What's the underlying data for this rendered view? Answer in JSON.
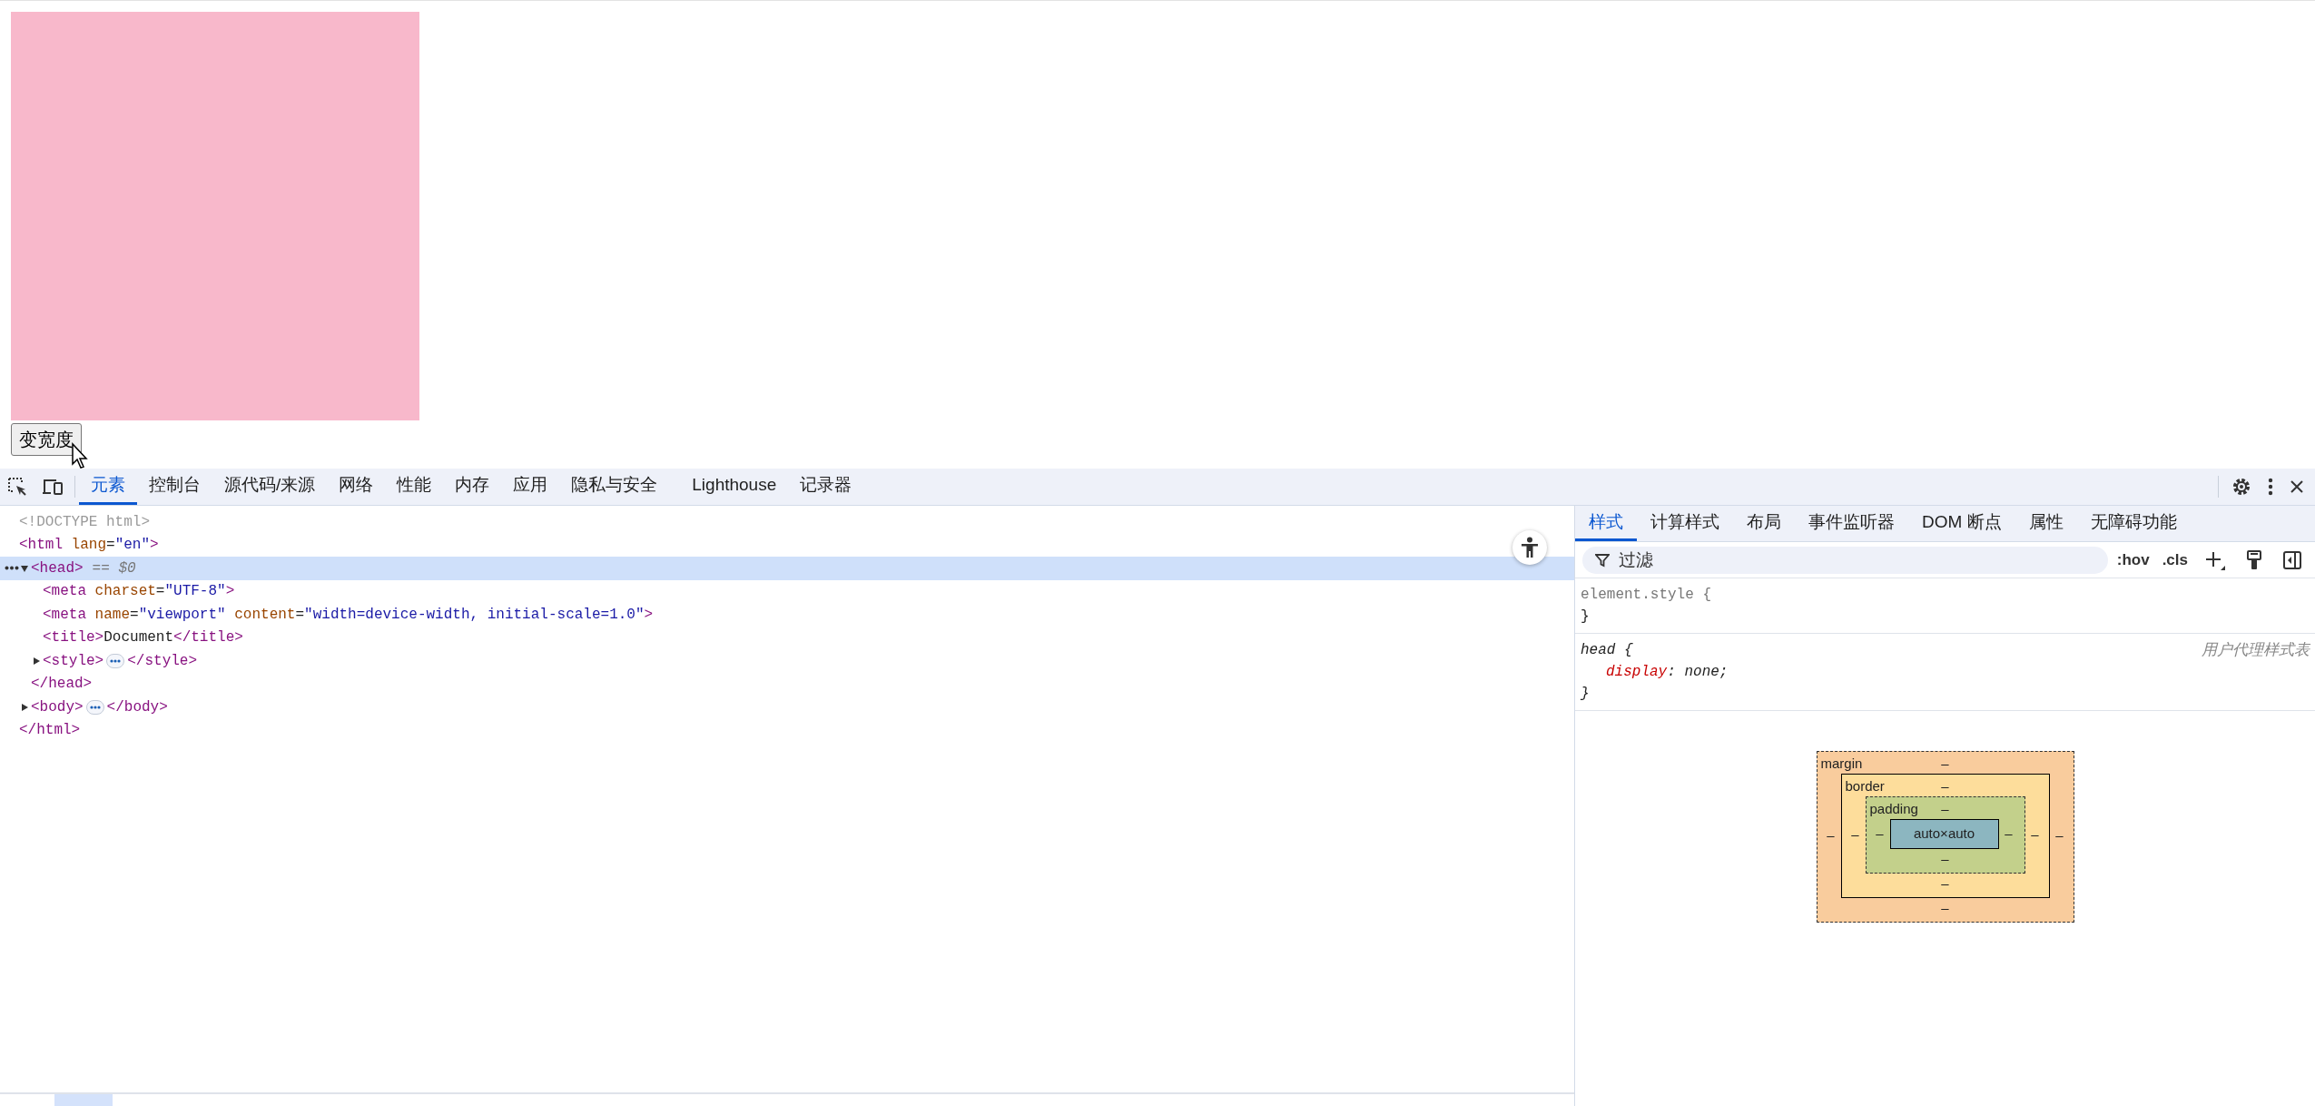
{
  "page": {
    "button": "变宽度"
  },
  "devtools": {
    "tabs": [
      {
        "label": "元素",
        "selected": true
      },
      {
        "label": "控制台",
        "selected": false
      },
      {
        "label": "源代码/来源",
        "selected": false
      },
      {
        "label": "网络",
        "selected": false
      },
      {
        "label": "性能",
        "selected": false
      },
      {
        "label": "内存",
        "selected": false
      },
      {
        "label": "应用",
        "selected": false
      },
      {
        "label": "隐私与安全",
        "selected": false
      },
      {
        "label": "Lighthouse",
        "selected": false
      },
      {
        "label": "记录器",
        "selected": false
      }
    ],
    "dom_tree": [
      {
        "selected": false,
        "tokens": [
          {
            "text": "<!DOCTYPE html>",
            "kind": "doctype"
          }
        ]
      },
      {
        "selected": false,
        "tokens": [
          {
            "text": "<html",
            "kind": "tag"
          },
          {
            "text": " lang",
            "kind": "attr"
          },
          {
            "text": "=",
            "kind": "punct"
          },
          {
            "text": "\"en\"",
            "kind": "value"
          },
          {
            "text": ">",
            "kind": "tag"
          }
        ],
        "close": [
          {
            "text": "</html>",
            "kind": "tag"
          }
        ],
        "children": [
          {
            "selected": true,
            "expanded": true,
            "hint": "== $0",
            "tokens": [
              {
                "text": "<head>",
                "kind": "tag"
              }
            ],
            "close": [
              {
                "text": "</head>",
                "kind": "tag"
              }
            ],
            "children": [
              {
                "selected": false,
                "tokens": [
                  {
                    "text": "<meta",
                    "kind": "tag"
                  },
                  {
                    "text": " charset",
                    "kind": "attr"
                  },
                  {
                    "text": "=",
                    "kind": "punct"
                  },
                  {
                    "text": "\"UTF-8\"",
                    "kind": "value"
                  },
                  {
                    "text": ">",
                    "kind": "tag"
                  }
                ]
              },
              {
                "selected": false,
                "tokens": [
                  {
                    "text": "<meta",
                    "kind": "tag"
                  },
                  {
                    "text": " name",
                    "kind": "attr"
                  },
                  {
                    "text": "=",
                    "kind": "punct"
                  },
                  {
                    "text": "\"viewport\"",
                    "kind": "value"
                  },
                  {
                    "text": " content",
                    "kind": "attr"
                  },
                  {
                    "text": "=",
                    "kind": "punct"
                  },
                  {
                    "text": "\"width=device-width, initial-scale=1.0\"",
                    "kind": "value"
                  },
                  {
                    "text": ">",
                    "kind": "tag"
                  }
                ]
              },
              {
                "selected": false,
                "tokens": [
                  {
                    "text": "<title>",
                    "kind": "tag"
                  },
                  {
                    "text": "Document",
                    "kind": "text"
                  },
                  {
                    "text": "</title>",
                    "kind": "tag"
                  }
                ]
              },
              {
                "selected": false,
                "expanded": false,
                "tokens": [
                  {
                    "text": "<style>",
                    "kind": "tag"
                  }
                ],
                "close": [
                  {
                    "text": "</style>",
                    "kind": "tag"
                  }
                ]
              }
            ]
          },
          {
            "selected": false,
            "expanded": false,
            "tokens": [
              {
                "text": "<body>",
                "kind": "tag"
              }
            ],
            "close": [
              {
                "text": "</body>",
                "kind": "tag"
              }
            ]
          }
        ]
      }
    ],
    "side_tabs": [
      {
        "label": "样式",
        "selected": true
      },
      {
        "label": "计算样式",
        "selected": false
      },
      {
        "label": "布局",
        "selected": false
      },
      {
        "label": "事件监听器",
        "selected": false
      },
      {
        "label": "DOM 断点",
        "selected": false
      },
      {
        "label": "属性",
        "selected": false
      },
      {
        "label": "无障碍功能",
        "selected": false
      }
    ],
    "filter": {
      "placeholder": "过滤"
    },
    "style_tools": [
      ":hov",
      ".cls"
    ],
    "rules": [
      {
        "kind": "inline",
        "selector": "element.style {",
        "close": "}"
      },
      {
        "kind": "user-agent",
        "selector": "head {",
        "origin": "用户代理样式表",
        "declarations": [
          {
            "name": "display",
            "punct": ":",
            "value": "none;"
          }
        ],
        "close": "}"
      }
    ],
    "box_model": {
      "margin": {
        "label": "margin",
        "top": "–",
        "right": "–",
        "bottom": "–",
        "left": "–"
      },
      "border": {
        "label": "border",
        "top": "–",
        "right": "–",
        "bottom": "–",
        "left": "–"
      },
      "padding": {
        "label": "padding",
        "top": "–",
        "right": "–",
        "bottom": "–",
        "left": "–"
      },
      "content": "auto×auto"
    }
  }
}
